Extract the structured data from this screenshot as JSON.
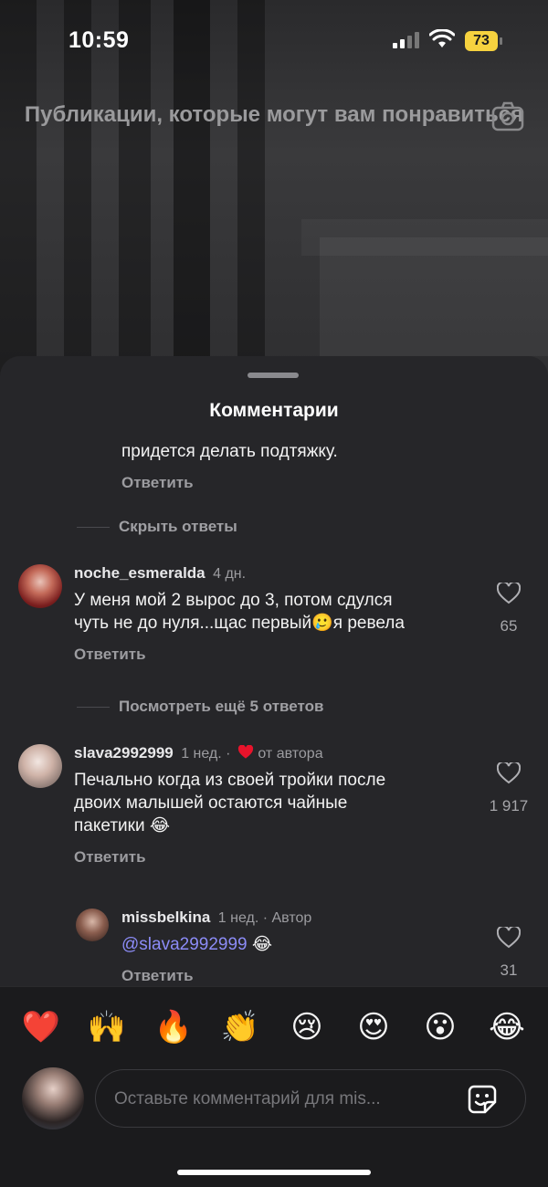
{
  "status_bar": {
    "time": "10:59",
    "battery": "73"
  },
  "feed": {
    "title": "Публикации, которые могут вам понравиться"
  },
  "sheet": {
    "title": "Комментарии"
  },
  "comments": {
    "prev_text_tail": "придется делать подтяжку.",
    "prev_reply_label": "Ответить",
    "hide_replies": "Скрыть ответы",
    "c1": {
      "user": "noche_esmeralda",
      "time": "4 дн.",
      "line1": "У меня мой 2 вырос до 3, потом сдулся",
      "line2a": "чуть не до нуля...щас первый",
      "line2b": "я ревела",
      "emoji": "🥲",
      "likes": "65",
      "reply_label": "Ответить"
    },
    "view_more": "Посмотреть ещё 5 ответов",
    "c2": {
      "user": "slava2992999",
      "time": "1 нед. ·",
      "from_author": "от автора",
      "line1": "Печально когда из своей тройки после",
      "line2": "двоих малышей остаются чайные",
      "line3": "пакетики",
      "emoji": "😂",
      "likes": "1 917",
      "reply_label": "Ответить"
    },
    "c3": {
      "user": "missbelkina",
      "time": "1 нед. · Автор",
      "mention": "@slava2992999",
      "emoji": "😂",
      "likes": "31",
      "reply_label": "Ответить"
    }
  },
  "reactions": [
    "❤️",
    "🙌",
    "🔥",
    "👏",
    "😢",
    "😍",
    "😮",
    "😂"
  ],
  "composer": {
    "placeholder": "Оставьте комментарий для mis..."
  },
  "colors": {
    "accent_mention": "#8c8cf7",
    "heart": "#e8132b",
    "battery": "#f6d23f"
  }
}
